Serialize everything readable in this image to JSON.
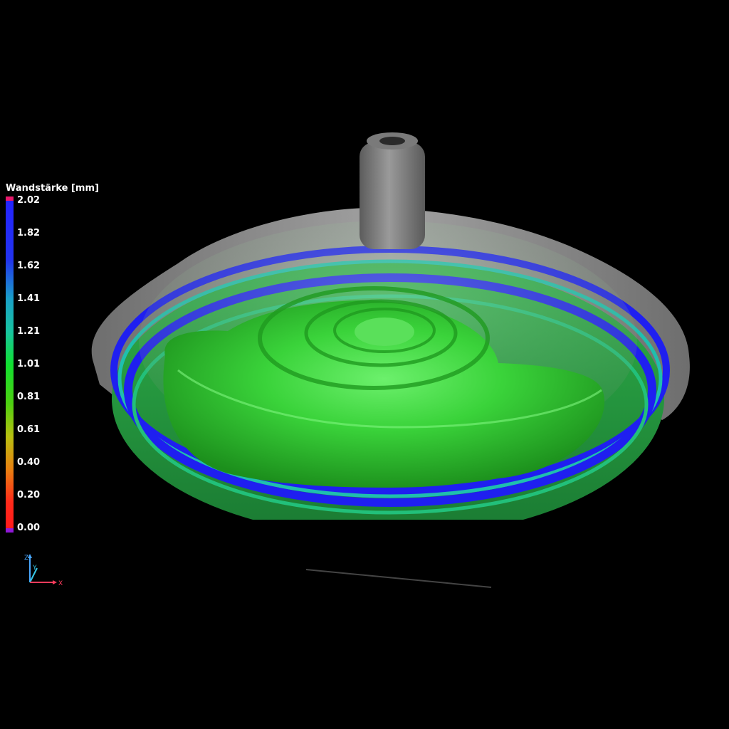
{
  "legend": {
    "title": "Wandstärke [mm]",
    "ticks": [
      "2.02",
      "1.82",
      "1.62",
      "1.41",
      "1.21",
      "1.01",
      "0.81",
      "0.61",
      "0.40",
      "0.20",
      "0.00"
    ],
    "colors": {
      "top_cap": "#e8186c",
      "high": "#1a1aff",
      "upper_mid": "#18b4b4",
      "mid": "#10e010",
      "low_mid": "#c8c810",
      "orange": "#e87810",
      "low": "#ff1a1a",
      "bottom_cap": "#9018d8"
    }
  },
  "axes": {
    "z": "Z",
    "y": "Y",
    "x": "X",
    "colors": {
      "x": "#ff3b5c",
      "y": "#36c6e8",
      "z": "#4aa8ff"
    }
  },
  "scene": {
    "part_colors": {
      "gray": "#8a8a8a",
      "green": "#3fd83f",
      "blue_ring": "#2222ee"
    }
  }
}
